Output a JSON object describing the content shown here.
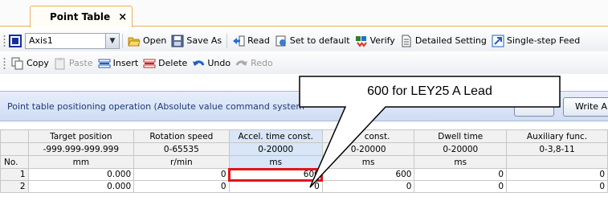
{
  "tab": {
    "label": "Point Table",
    "close": "×"
  },
  "toolbar1": {
    "axis_value": "Axis1",
    "open": "Open",
    "save_as": "Save As",
    "read": "Read",
    "set_default": "Set to default",
    "verify": "Verify",
    "detailed_setting": "Detailed Setting",
    "single_step": "Single-step Feed"
  },
  "toolbar2": {
    "copy": "Copy",
    "paste": "Paste",
    "insert": "Insert",
    "delete": "Delete",
    "undo": "Undo",
    "redo": "Redo"
  },
  "info": {
    "message": "Point table positioning operation (Absolute value command system",
    "write_button": "Write A"
  },
  "table": {
    "headers": [
      "",
      "Target position",
      "Rotation speed",
      "Accel. time const.",
      "const.",
      "Dwell time",
      "Auxiliary func."
    ],
    "ranges": [
      "",
      "-999.999-999.999",
      "0-65535",
      "0-20000",
      "0-20000",
      "0-20000",
      "0-3,8-11"
    ],
    "units": [
      "No.",
      "mm",
      "r/min",
      "ms",
      "ms",
      "ms",
      ""
    ],
    "rows": [
      [
        "1",
        "0.000",
        "0",
        "600",
        "600",
        "0",
        "0"
      ],
      [
        "2",
        "0.000",
        "0",
        "0",
        "0",
        "0",
        "0"
      ]
    ]
  },
  "callout": {
    "text": "600 for LEY25 A Lead"
  },
  "colors": {
    "highlight": "#e0161b",
    "selected_header": "#d8e6f7",
    "tab_border": "#e6b35a"
  }
}
